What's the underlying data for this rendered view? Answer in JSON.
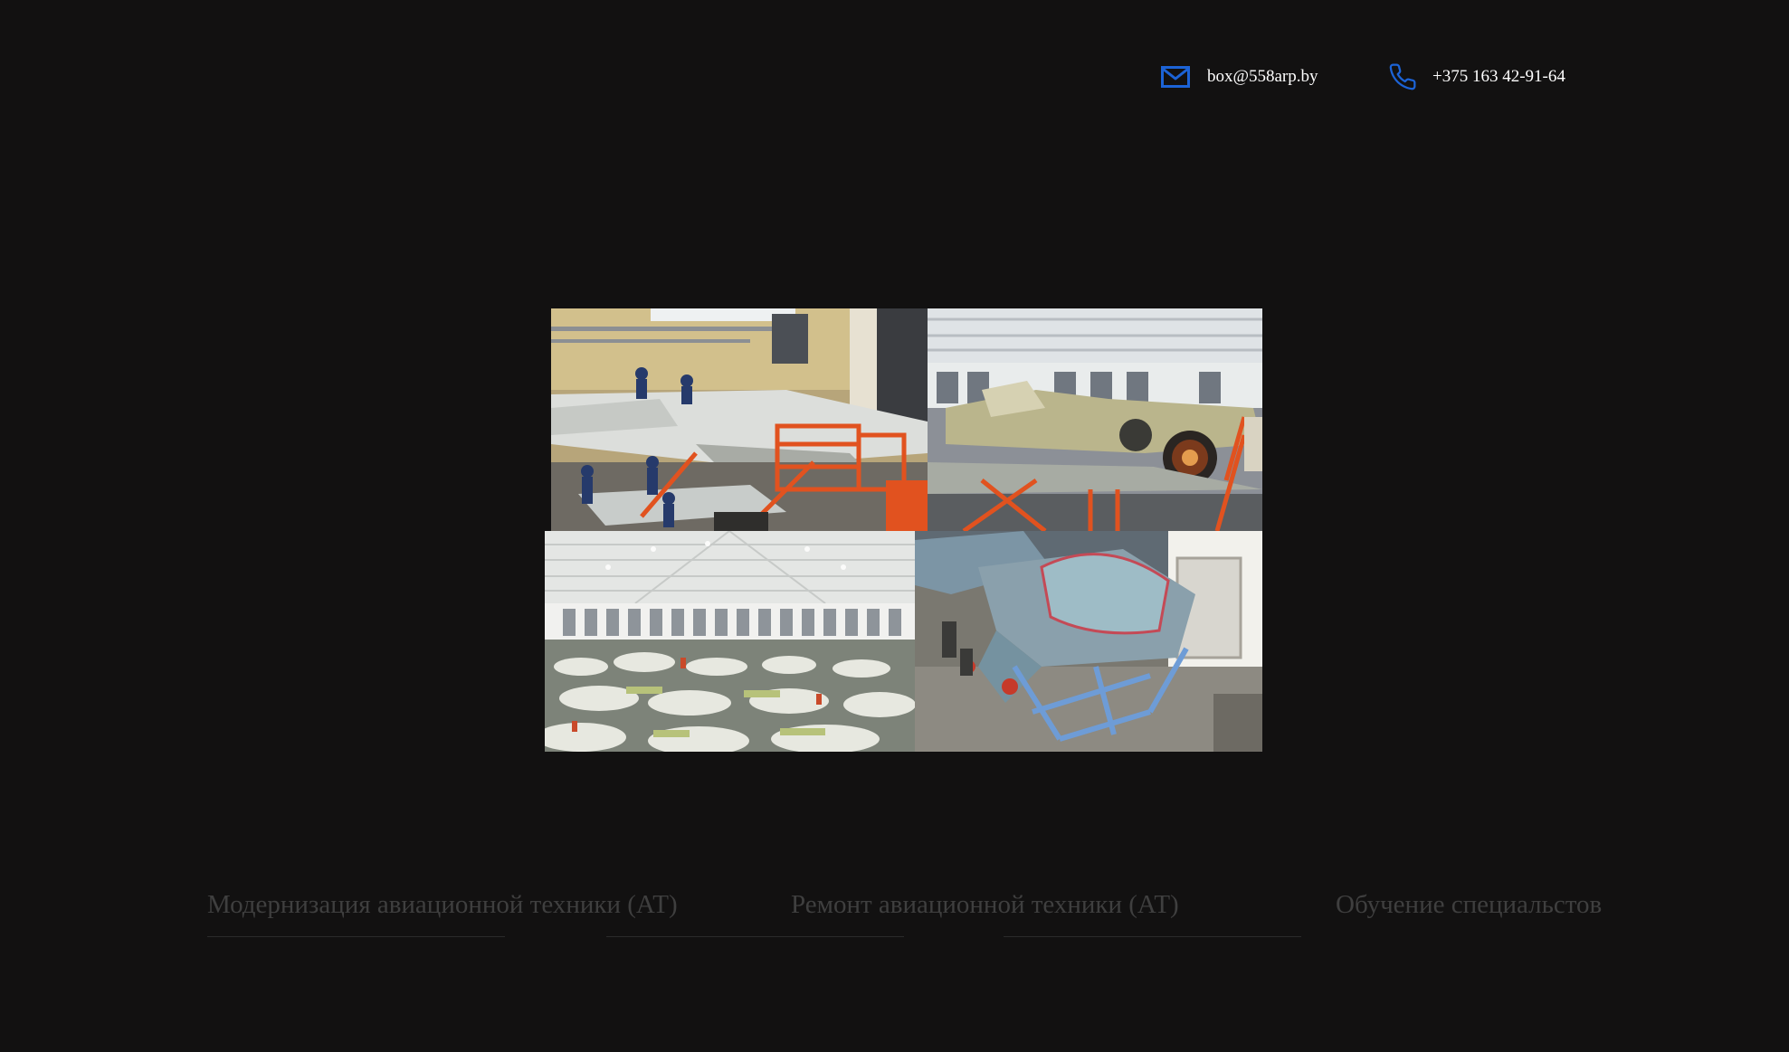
{
  "header": {
    "email": {
      "icon": "envelope-icon",
      "text": "box@558arp.by"
    },
    "phone": {
      "icon": "phone-icon",
      "text": "+375 163 42-91-64"
    },
    "accent_color": "#1c63d6"
  },
  "gallery": {
    "photos": [
      {
        "name": "aircraft-maintenance-scaffold-photo"
      },
      {
        "name": "aircraft-engine-repair-photo"
      },
      {
        "name": "hangar-overview-photo"
      },
      {
        "name": "cockpit-section-photo"
      }
    ]
  },
  "services": [
    {
      "label": "Модернизация авиационной техники (АТ)"
    },
    {
      "label": "Ремонт авиационной техники (АТ)"
    },
    {
      "label": "Обучение специальстов"
    }
  ],
  "colors": {
    "background": "#121111",
    "service_text": "#3f3f3f",
    "contact_text": "#ffffff"
  }
}
